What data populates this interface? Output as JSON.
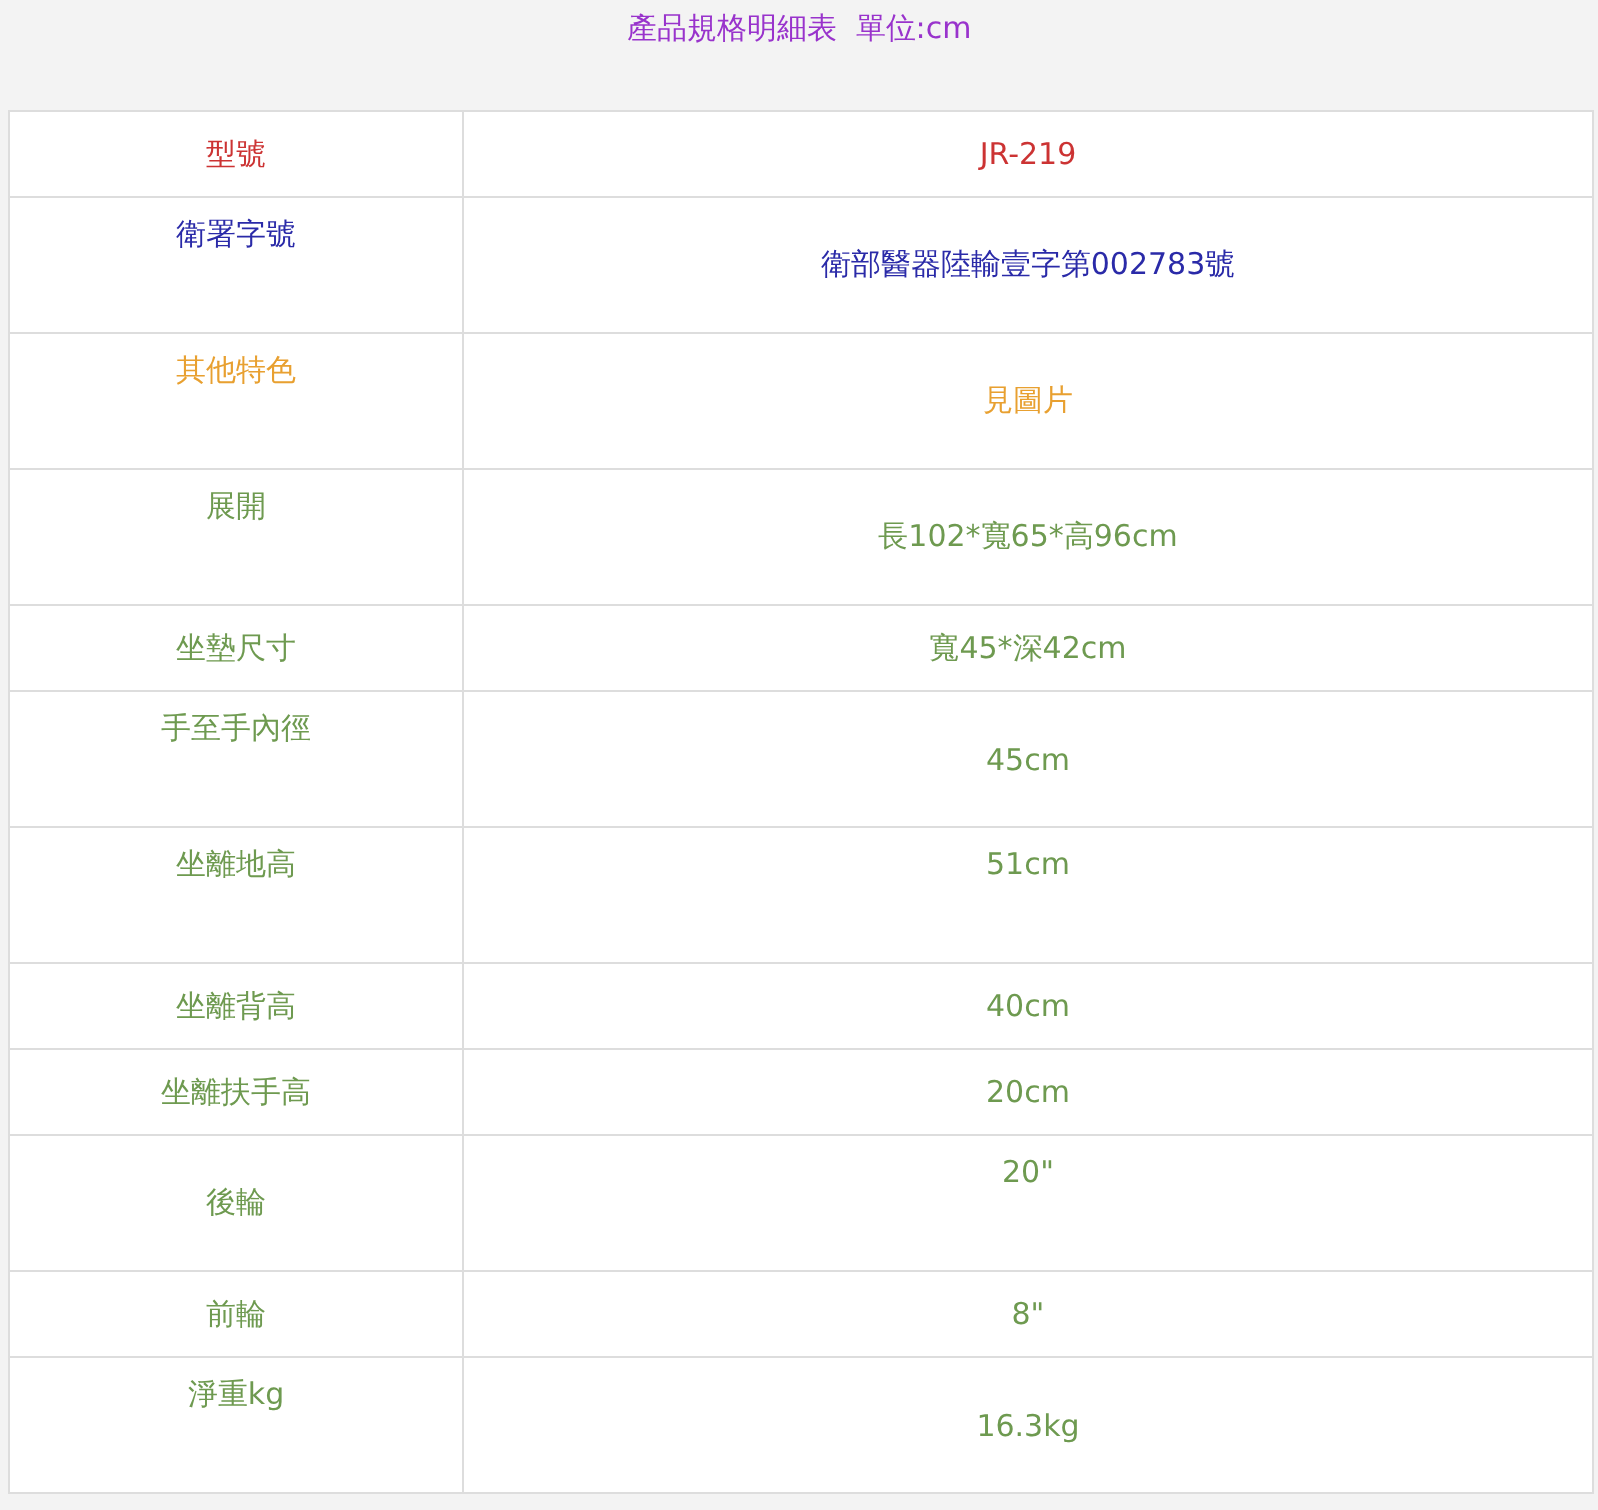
{
  "title": "產品規格明細表  單位:cm",
  "rows": [
    {
      "label": "型號",
      "value": "JR-219",
      "color": "#cc3333",
      "kind": "short"
    },
    {
      "label": "衛署字號",
      "value": "衛部醫器陸輸壹字第002783號",
      "color": "#2a2aa8",
      "kind": "label-top"
    },
    {
      "label": "其他特色",
      "value": "見圖片",
      "color": "#e8a030",
      "kind": "label-top"
    },
    {
      "label": "展開",
      "value": "長102*寬65*高96cm",
      "color": "#6e9a50",
      "kind": "label-top"
    },
    {
      "label": "坐墊尺寸",
      "value": "寬45*深42cm",
      "color": "#6e9a50",
      "kind": "short"
    },
    {
      "label": "手至手內徑",
      "value": "45cm",
      "color": "#6e9a50",
      "kind": "label-top"
    },
    {
      "label": "坐離地高",
      "value": "51cm",
      "color": "#6e9a50",
      "kind": "top"
    },
    {
      "label": "坐離背高",
      "value": "40cm",
      "color": "#6e9a50",
      "kind": "short"
    },
    {
      "label": "坐離扶手高",
      "value": "20cm",
      "color": "#6e9a50",
      "kind": "short"
    },
    {
      "label": "後輪",
      "value": "20\"",
      "color": "#6e9a50",
      "kind": "value-top"
    },
    {
      "label": "前輪",
      "value": "8\"",
      "color": "#6e9a50",
      "kind": "short"
    },
    {
      "label": "淨重kg",
      "value": "16.3kg",
      "color": "#6e9a50",
      "kind": "label-top"
    }
  ]
}
